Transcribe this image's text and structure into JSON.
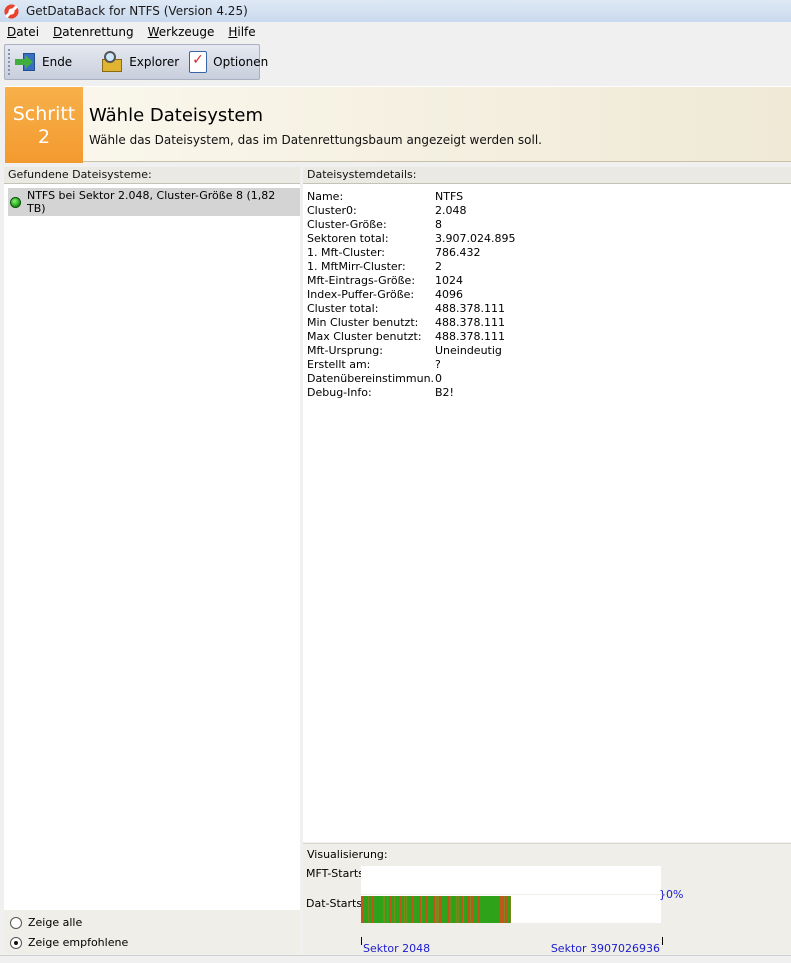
{
  "window": {
    "title": "GetDataBack for NTFS (Version 4.25)"
  },
  "menu": [
    {
      "label": "Datei",
      "accel": "D"
    },
    {
      "label": "Datenrettung",
      "accel": "D"
    },
    {
      "label": "Werkzeuge",
      "accel": "W"
    },
    {
      "label": "Hilfe",
      "accel": "H"
    }
  ],
  "toolbar": {
    "exit_label": "Ende",
    "explorer_label": "Explorer",
    "options_label": "Optionen"
  },
  "step": {
    "word": "Schritt",
    "number": "2",
    "title": "Wähle Dateisystem",
    "description": "Wähle das Dateisystem, das im Datenrettungsbaum angezeigt werden soll."
  },
  "left": {
    "header": "Gefundene Dateisysteme:",
    "items": [
      {
        "label": "NTFS bei Sektor 2.048, Cluster-Größe 8 (1,82 TB)",
        "status": "green"
      }
    ],
    "radios": [
      {
        "label": "Zeige alle",
        "checked": false
      },
      {
        "label": "Zeige empfohlene",
        "checked": true
      }
    ]
  },
  "details": {
    "header": "Dateisystemdetails:",
    "rows": [
      {
        "label": "Name:",
        "value": "NTFS"
      },
      {
        "label": "Cluster0:",
        "value": "2.048"
      },
      {
        "label": "Cluster-Größe:",
        "value": "8"
      },
      {
        "label": "Sektoren total:",
        "value": "3.907.024.895"
      },
      {
        "label": "1. Mft-Cluster:",
        "value": "786.432"
      },
      {
        "label": "1. MftMirr-Cluster:",
        "value": "2"
      },
      {
        "label": "Mft-Eintrags-Größe:",
        "value": "1024"
      },
      {
        "label": "Index-Puffer-Größe:",
        "value": "4096"
      },
      {
        "label": "Cluster total:",
        "value": "488.378.111"
      },
      {
        "label": "Min Cluster benutzt:",
        "value": "488.378.111"
      },
      {
        "label": "Max Cluster benutzt:",
        "value": "488.378.111"
      },
      {
        "label": "Mft-Ursprung:",
        "value": "Uneindeutig"
      },
      {
        "label": "Erstellt am:",
        "value": "?"
      },
      {
        "label": "Datenübereinstimmun...",
        "value": "0"
      },
      {
        "label": "Debug-Info:",
        "value": "B2!"
      }
    ]
  },
  "visualization": {
    "title": "Visualisierung:",
    "mft_label": "MFT-Starts",
    "dat_label": "Dat-Starts:",
    "percent": "}0%",
    "dat_fill_fraction": 0.5,
    "colors": {
      "green": "#2ea31a",
      "orange": "#c1531c"
    },
    "scale_left": "Sektor 2048",
    "scale_right": "Sektor 3907026936"
  }
}
